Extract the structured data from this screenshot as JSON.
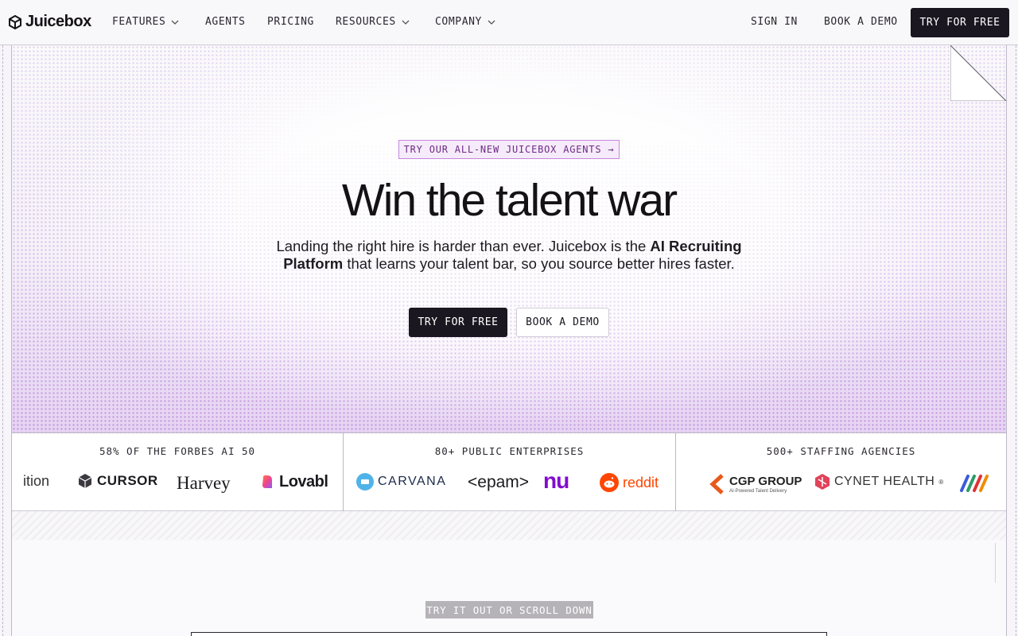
{
  "brand": {
    "name": "Juicebox"
  },
  "nav": {
    "items": [
      {
        "label": "FEATURES",
        "dropdown": true
      },
      {
        "label": "AGENTS",
        "dropdown": false
      },
      {
        "label": "PRICING",
        "dropdown": false
      },
      {
        "label": "RESOURCES",
        "dropdown": true
      },
      {
        "label": "COMPANY",
        "dropdown": true
      }
    ],
    "sign_in": "SIGN IN",
    "book_demo": "BOOK A DEMO",
    "try_free": "TRY FOR FREE"
  },
  "hero": {
    "pill": "TRY OUR ALL-NEW JUICEBOX AGENTS →",
    "headline": "Win the talent war",
    "sub_part1": "Landing the right hire is harder than ever. Juicebox is the ",
    "sub_bold": "AI Recruiting Platform",
    "sub_part2": " that learns your talent bar, so you source better hires faster.",
    "cta_primary": "TRY FOR FREE",
    "cta_secondary": "BOOK A DEMO"
  },
  "logos": {
    "col1": {
      "title": "58% OF THE FORBES AI 50",
      "items": [
        "ition",
        "CURSOR",
        "Harvey",
        "Lovabl"
      ]
    },
    "col2": {
      "title": "80+ PUBLIC ENTERPRISES",
      "items": [
        "CARVANA",
        "<epam>",
        "nu",
        "reddit"
      ]
    },
    "col3": {
      "title": "500+ STAFFING AGENCIES",
      "items": [
        "CGP GROUP",
        "AI-Powered Talent Delivery",
        "CYNET HEALTH",
        "®"
      ]
    }
  },
  "scroll_tag": "TRY IT OUT OR SCROLL DOWN",
  "colors": {
    "accent_purple": "#c887dd",
    "dark": "#1a1720",
    "reddit": "#ff4500",
    "nu": "#820ad1",
    "cgp": "#e85a1b",
    "cynet": "#e0435a"
  }
}
